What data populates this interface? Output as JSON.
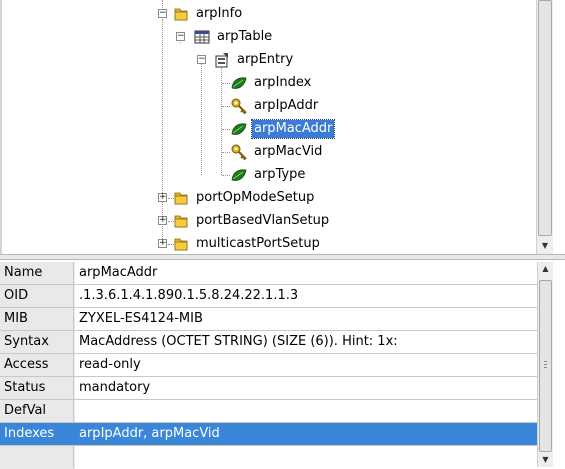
{
  "tree": {
    "nodes": [
      {
        "label": "arpInfo",
        "icon": "folder-icon",
        "expander": "minus"
      },
      {
        "label": "arpTable",
        "icon": "table-icon",
        "expander": "minus"
      },
      {
        "label": "arpEntry",
        "icon": "entry-icon",
        "expander": "minus"
      },
      {
        "label": "arpIndex",
        "icon": "leaf-icon"
      },
      {
        "label": "arpIpAddr",
        "icon": "key-icon"
      },
      {
        "label": "arpMacAddr",
        "icon": "leaf-icon",
        "selected": true
      },
      {
        "label": "arpMacVid",
        "icon": "key-icon"
      },
      {
        "label": "arpType",
        "icon": "leaf-icon"
      },
      {
        "label": "portOpModeSetup",
        "icon": "folder-icon",
        "expander": "plus"
      },
      {
        "label": "portBasedVlanSetup",
        "icon": "folder-icon",
        "expander": "plus"
      },
      {
        "label": "multicastPortSetup",
        "icon": "folder-icon",
        "expander": "plus"
      }
    ]
  },
  "properties": {
    "rows": [
      {
        "key": "Name",
        "value": "arpMacAddr"
      },
      {
        "key": "OID",
        "value": ".1.3.6.1.4.1.890.1.5.8.24.22.1.1.3"
      },
      {
        "key": "MIB",
        "value": "ZYXEL-ES4124-MIB"
      },
      {
        "key": "Syntax",
        "value": "MacAddress (OCTET STRING) (SIZE (6)). Hint: 1x:"
      },
      {
        "key": "Access",
        "value": "read-only"
      },
      {
        "key": "Status",
        "value": "mandatory"
      },
      {
        "key": "DefVal",
        "value": ""
      },
      {
        "key": "Indexes",
        "value": "arpIpAddr, arpMacVid",
        "selected": true
      },
      {
        "key": "",
        "value": ""
      }
    ]
  },
  "colors": {
    "selection": "#3a86d8",
    "folder": "#e8b520",
    "leaf": "#1f7a1f",
    "key": "#d8b020",
    "label_column_bg": "#e9e9e9"
  }
}
